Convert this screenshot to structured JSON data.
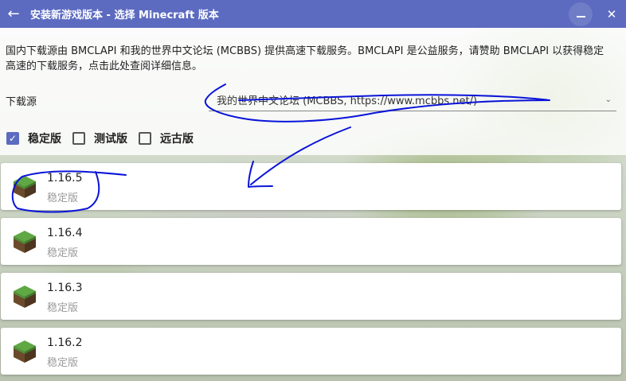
{
  "window": {
    "title": "安装新游戏版本 - 选择 Minecraft 版本",
    "back_icon": "back-arrow-icon",
    "minimize_icon": "minimize-icon",
    "close_icon": "close-icon"
  },
  "notice": "国内下载源由 BMCLAPI 和我的世界中文论坛 (MCBBS) 提供高速下载服务。BMCLAPI 是公益服务，请赞助 BMCLAPI 以获得稳定高速的下载服务，点击此处查阅详细信息。",
  "download_source": {
    "label": "下载源",
    "selected": "我的世界中文论坛 (MCBBS, https://www.mcbbs.net/)"
  },
  "filters": [
    {
      "label": "稳定版",
      "checked": true
    },
    {
      "label": "测试版",
      "checked": false
    },
    {
      "label": "远古版",
      "checked": false
    }
  ],
  "versions": [
    {
      "version": "1.16.5",
      "type": "稳定版",
      "icon": "grass-block-icon"
    },
    {
      "version": "1.16.4",
      "type": "稳定版",
      "icon": "grass-block-icon"
    },
    {
      "version": "1.16.3",
      "type": "稳定版",
      "icon": "grass-block-icon"
    },
    {
      "version": "1.16.2",
      "type": "稳定版",
      "icon": "grass-block-icon"
    }
  ],
  "colors": {
    "accent": "#5c6bc0",
    "annotation_ink": "#0a14d8"
  }
}
